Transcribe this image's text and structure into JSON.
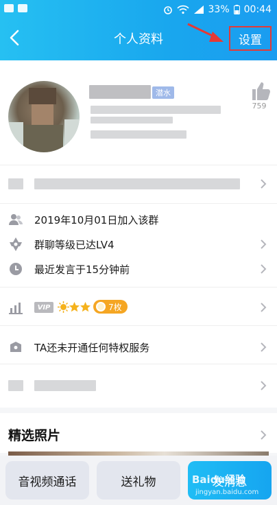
{
  "status_bar": {
    "battery": "33%",
    "time": "00:44"
  },
  "nav": {
    "title": "个人资料",
    "settings_label": "设置"
  },
  "profile": {
    "tag": "潜水",
    "like_count": "759"
  },
  "info_rows": {
    "joined": "2019年10月01日加入该群",
    "level": "群聊等级已达LV4",
    "last_spoke": "最近发言于15分钟前",
    "vip_badge": "VIP",
    "gift_count": "7枚",
    "privilege": "TA还未开通任何特权服务"
  },
  "photos": {
    "title": "精选照片"
  },
  "bottom_bar": {
    "call_label": "音视频通话",
    "gift_label": "送礼物",
    "message_label": "发消息"
  },
  "watermark": {
    "text": "Baidu经验",
    "sub": "jingyan.baidu.com"
  },
  "colors": {
    "header_start": "#26c0f2",
    "header_end": "#1a9cf0",
    "highlight_box": "#e53935",
    "gift_pill": "#f5a623"
  }
}
